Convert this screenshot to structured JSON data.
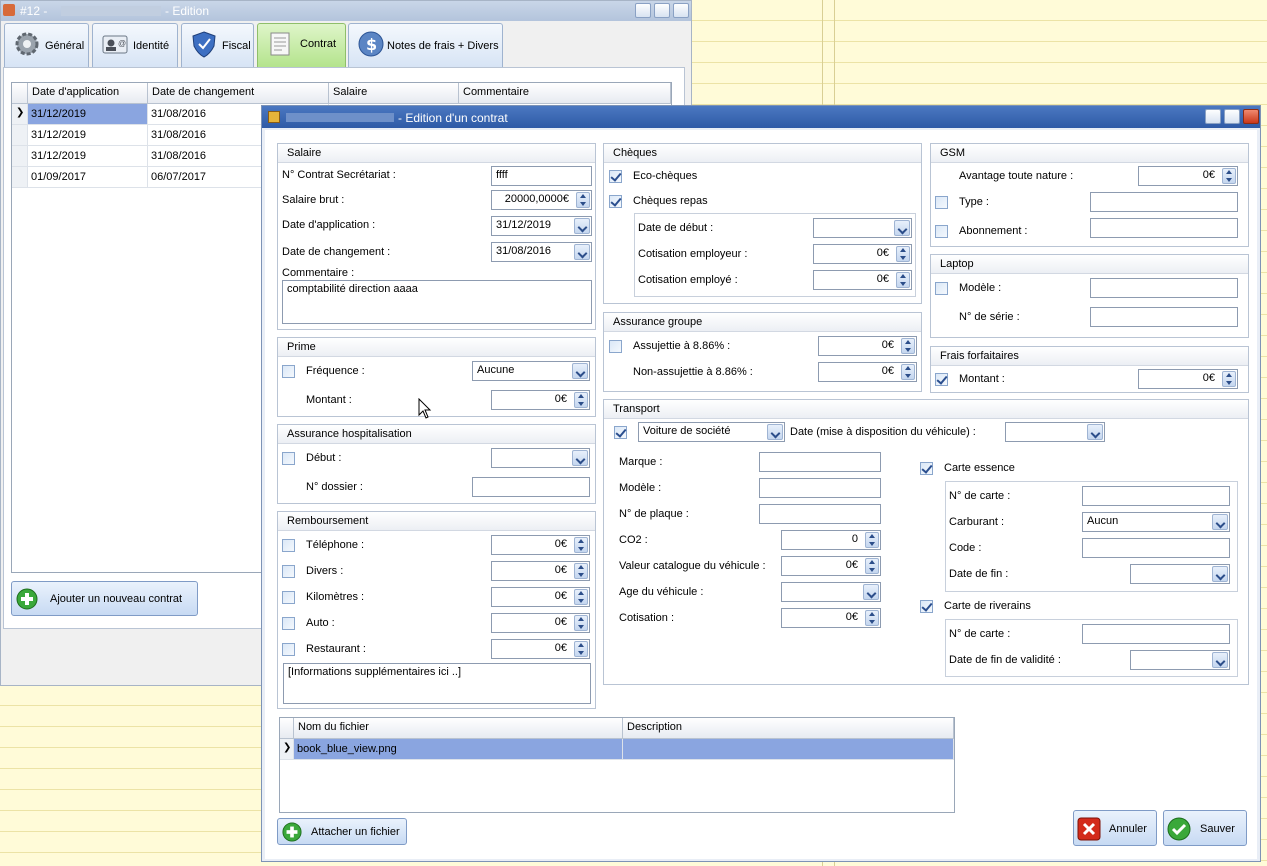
{
  "main_window": {
    "title": "#12 - ",
    "title_suffix": "- Edition",
    "tabs": [
      {
        "label": "Général",
        "icon": "gear-icon"
      },
      {
        "label": "Identité",
        "icon": "id-card-icon"
      },
      {
        "label": "Fiscal",
        "icon": "shield-icon"
      },
      {
        "label": "Contrat",
        "icon": "contract-icon"
      },
      {
        "label": "Notes de frais + Divers",
        "icon": "dollar-icon"
      }
    ],
    "active_tab": "Contrat",
    "contracts_table": {
      "columns": [
        "Date d'application",
        "Date de changement",
        "Salaire",
        "Commentaire"
      ],
      "rows": [
        [
          "31/12/2019",
          "31/08/2016"
        ],
        [
          "31/12/2019",
          "31/08/2016"
        ],
        [
          "31/12/2019",
          "31/08/2016"
        ],
        [
          "01/09/2017",
          "06/07/2017"
        ]
      ]
    },
    "add_contract_label": "Ajouter un nouveau contrat"
  },
  "dialog": {
    "title": "- Edition d'un contrat",
    "salaire": {
      "header": "Salaire",
      "contrat_label": "N° Contrat Secrétariat :",
      "contrat_value": "ffff",
      "brut_label": "Salaire brut :",
      "brut_value": "20000,0000€",
      "date_app_label": "Date d'application :",
      "date_app_value": "31/12/2019",
      "date_chg_label": "Date de changement :",
      "date_chg_value": "31/08/2016",
      "commentaire_label": "Commentaire :",
      "commentaire_value": "comptabilité direction aaaa"
    },
    "prime": {
      "header": "Prime",
      "frequence_label": "Fréquence :",
      "frequence_value": "Aucune",
      "montant_label": "Montant :",
      "montant_value": "0€"
    },
    "hospitalisation": {
      "header": "Assurance hospitalisation",
      "debut_label": "Début :",
      "dossier_label": "N° dossier :"
    },
    "remboursement": {
      "header": "Remboursement",
      "items": [
        {
          "label": "Téléphone :",
          "value": "0€"
        },
        {
          "label": "Divers :",
          "value": "0€"
        },
        {
          "label": "Kilomètres :",
          "value": "0€"
        },
        {
          "label": "Auto :",
          "value": "0€"
        },
        {
          "label": "Restaurant :",
          "value": "0€"
        }
      ],
      "info_placeholder": "[Informations supplémentaires ici ..]"
    },
    "cheques": {
      "header": "Chèques",
      "eco_label": "Eco-chèques",
      "repas_label": "Chèques repas",
      "date_debut_label": "Date de début :",
      "cot_employeur_label": "Cotisation employeur :",
      "cot_employeur_value": "0€",
      "cot_employe_label": "Cotisation employé :",
      "cot_employe_value": "0€"
    },
    "assurance_groupe": {
      "header": "Assurance groupe",
      "assujettie_label": "Assujettie à 8.86% :",
      "assujettie_value": "0€",
      "non_assujettie_label": "Non-assujettie à 8.86% :",
      "non_assujettie_value": "0€"
    },
    "gsm": {
      "header": "GSM",
      "avantage_label": "Avantage toute nature :",
      "avantage_value": "0€",
      "type_label": "Type :",
      "abonnement_label": "Abonnement :"
    },
    "laptop": {
      "header": "Laptop",
      "modele_label": "Modèle :",
      "serie_label": "N° de série :"
    },
    "frais": {
      "header": "Frais forfaitaires",
      "montant_label": "Montant :",
      "montant_value": "0€"
    },
    "transport": {
      "header": "Transport",
      "vehicule_value": "Voiture de société",
      "date_label": "Date (mise à disposition du véhicule) :",
      "marque_label": "Marque :",
      "modele_label": "Modèle :",
      "plaque_label": "N° de plaque :",
      "co2_label": "CO2 :",
      "co2_value": "0",
      "valeur_label": "Valeur catalogue du véhicule :",
      "valeur_value": "0€",
      "age_label": "Age du véhicule :",
      "cotisation_label": "Cotisation :",
      "cotisation_value": "0€",
      "carte_essence_label": "Carte essence",
      "carte_num_label": "N° de carte :",
      "carburant_label": "Carburant :",
      "carburant_value": "Aucun",
      "code_label": "Code :",
      "date_fin_label": "Date de fin :",
      "riverains_label": "Carte de riverains",
      "riv_num_label": "N° de carte :",
      "riv_date_label": "Date de fin de validité :"
    },
    "files": {
      "columns": [
        "Nom du fichier",
        "Description"
      ],
      "rows": [
        [
          "book_blue_view.png",
          ""
        ]
      ]
    },
    "attach_label": "Attacher un fichier",
    "cancel_label": "Annuler",
    "save_label": "Sauver"
  }
}
